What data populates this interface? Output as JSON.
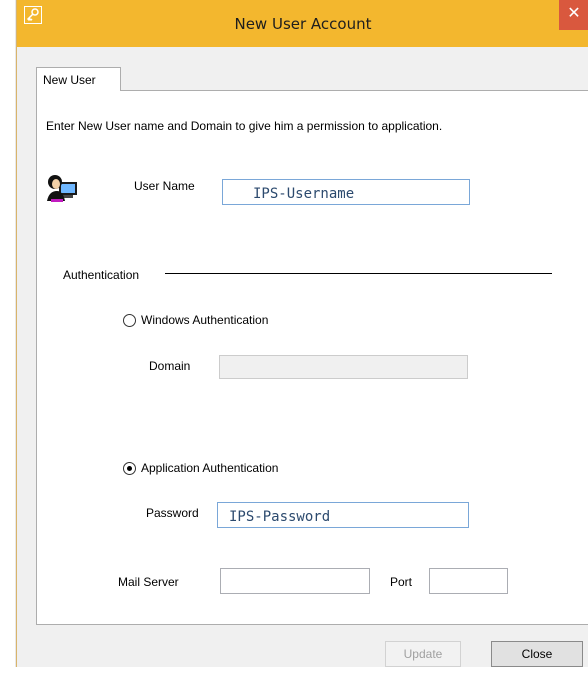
{
  "window": {
    "title": "New User Account",
    "close_glyph": "✕",
    "colors": {
      "titlebar": "#f3b72e",
      "close": "#d9583e",
      "input_border": "#7aa7d8"
    }
  },
  "tabs": [
    {
      "label": "New User",
      "selected": true
    }
  ],
  "form": {
    "intro": "Enter New User name and Domain to give him a permission to application.",
    "username": {
      "label": "User Name",
      "value": "IPS-Username"
    },
    "authentication": {
      "group_label": "Authentication",
      "windows": {
        "label": "Windows Authentication",
        "checked": false
      },
      "domain": {
        "label": "Domain",
        "value": "",
        "enabled": false
      },
      "application": {
        "label": "Application Authentication",
        "checked": true
      },
      "password": {
        "label": "Password",
        "value": "IPS-Password"
      }
    },
    "mail_server": {
      "label": "Mail Server",
      "value": ""
    },
    "port": {
      "label": "Port",
      "value": ""
    }
  },
  "buttons": {
    "update": {
      "label": "Update",
      "enabled": false
    },
    "close": {
      "label": "Close",
      "enabled": true
    }
  },
  "icons": {
    "app": "key-icon",
    "user": "user-computer-icon"
  }
}
